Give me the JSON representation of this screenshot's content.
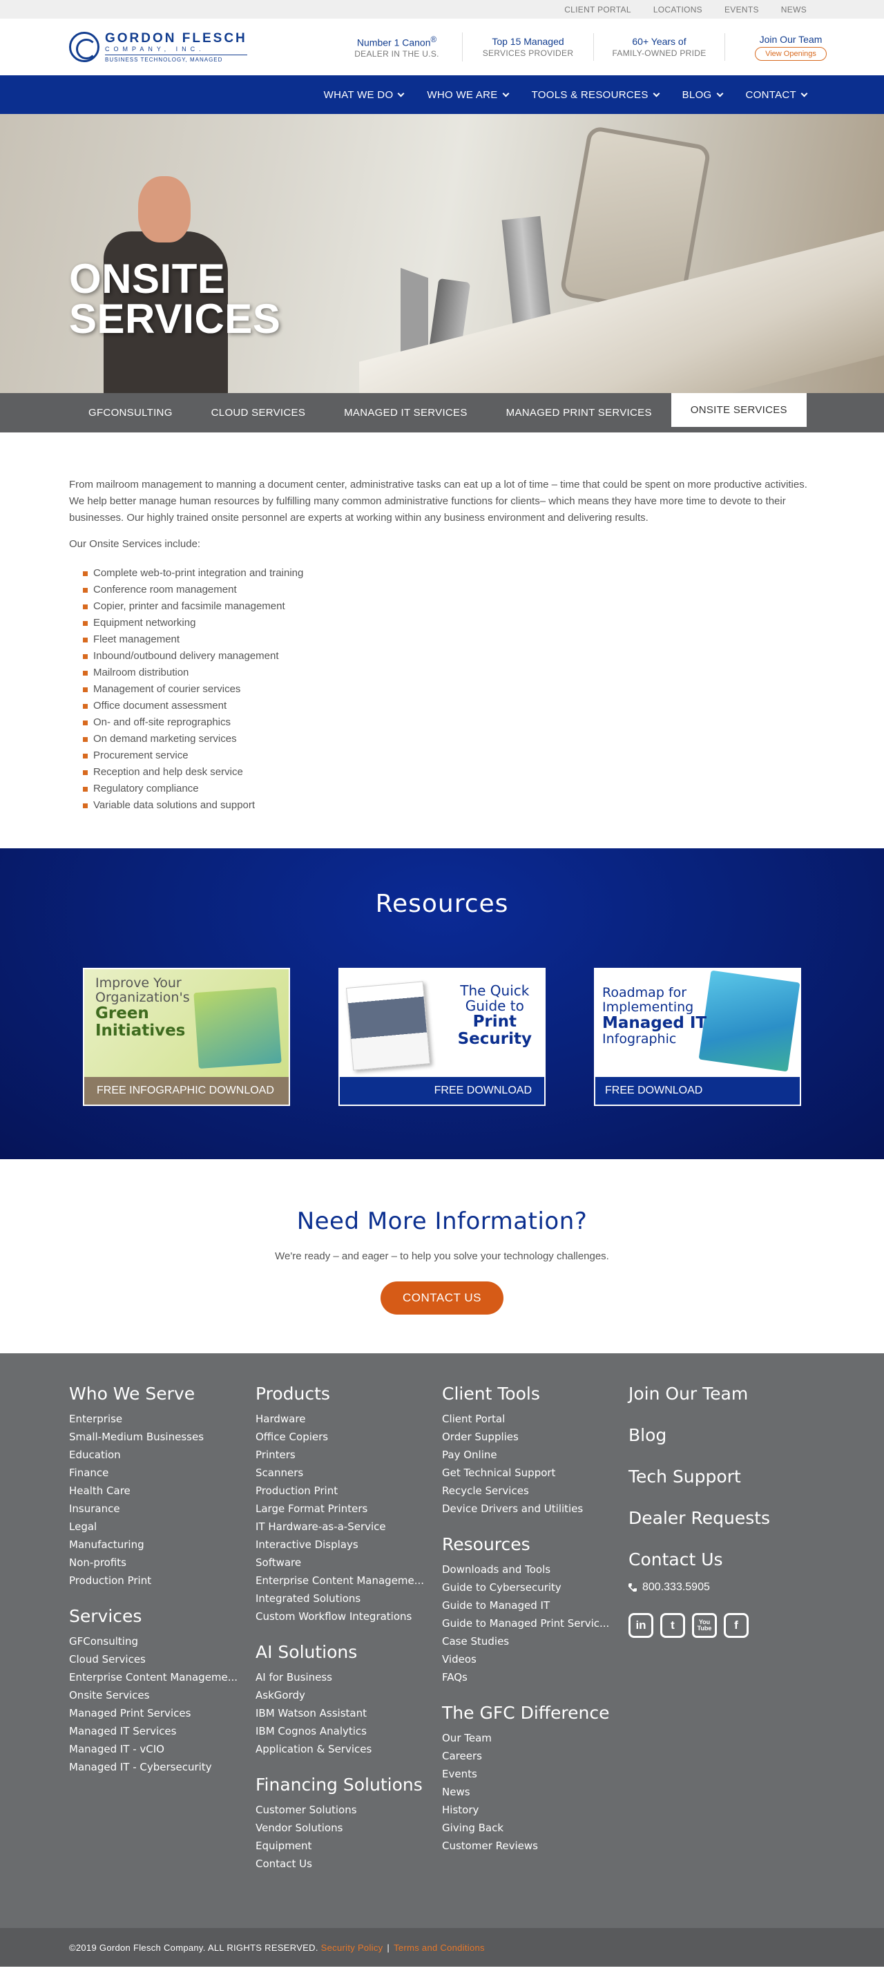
{
  "utility": [
    "CLIENT PORTAL",
    "LOCATIONS",
    "EVENTS",
    "NEWS"
  ],
  "logo": {
    "name": "GORDON FLESCH",
    "company": "COMPANY, INC.",
    "tagline": "BUSINESS TECHNOLOGY, MANAGED"
  },
  "badges": [
    {
      "top": "Number 1 Canon",
      "top_sup": "®",
      "bottom": "DEALER IN THE U.S."
    },
    {
      "top": "Top 15 Managed",
      "bottom": "SERVICES PROVIDER"
    },
    {
      "top": "60+ Years of",
      "bottom": "FAMILY-OWNED PRIDE"
    },
    {
      "top": "Join Our Team",
      "button": "View Openings"
    }
  ],
  "nav": [
    "WHAT WE DO",
    "WHO WE ARE",
    "TOOLS & RESOURCES",
    "BLOG",
    "CONTACT"
  ],
  "hero": {
    "title_line1": "ONSITE",
    "title_line2": "SERVICES"
  },
  "subtabs": [
    "GFCONSULTING",
    "CLOUD SERVICES",
    "MANAGED IT SERVICES",
    "MANAGED PRINT SERVICES",
    "ONSITE SERVICES"
  ],
  "content": {
    "intro": "From mailroom management to manning a document center, administrative tasks can eat up a lot of time – time that could be spent on more productive activities. We help better manage human resources by fulfilling many common administrative functions for clients– which means they have more time to devote to their businesses. Our highly trained onsite personnel are experts at working within any business environment and delivering results.",
    "list_heading": "Our Onsite Services include:",
    "services": [
      "Complete web-to-print integration and training",
      "Conference room management",
      "Copier, printer and facsimile management",
      "Equipment networking",
      "Fleet management",
      "Inbound/outbound delivery management",
      "Mailroom distribution",
      "Management of courier services",
      "Office document assessment",
      "On- and off-site reprographics",
      "On demand marketing services",
      "Procurement service",
      "Reception and help desk service",
      "Regulatory compliance",
      "Variable data solutions and support"
    ]
  },
  "resources": {
    "heading": "Resources",
    "cards": [
      {
        "l1": "Improve Your",
        "l2": "Organization's",
        "l3": "Green",
        "l4": "Initiatives",
        "footer": "FREE INFOGRAPHIC DOWNLOAD"
      },
      {
        "l1": "The Quick",
        "l2": "Guide to",
        "l3": "Print",
        "l4": "Security",
        "footer": "FREE DOWNLOAD"
      },
      {
        "l1": "Roadmap for",
        "l2": "Implementing",
        "l3": "Managed IT",
        "l4": "Infographic",
        "footer": "FREE DOWNLOAD"
      }
    ]
  },
  "cta": {
    "heading": "Need More Information?",
    "text": "We're ready – and eager – to help you solve your technology challenges.",
    "button": "CONTACT US"
  },
  "footer": {
    "who_we_serve": {
      "title": "Who We Serve",
      "items": [
        "Enterprise",
        "Small-Medium Businesses",
        "Education",
        "Finance",
        "Health Care",
        "Insurance",
        "Legal",
        "Manufacturing",
        "Non-profits",
        "Production Print"
      ]
    },
    "services": {
      "title": "Services",
      "items": [
        "GFConsulting",
        "Cloud Services",
        "Enterprise Content Manageme...",
        "Onsite Services",
        "Managed Print Services",
        "Managed IT Services",
        "Managed IT - vCIO",
        "Managed IT - Cybersecurity"
      ]
    },
    "products": {
      "title": "Products",
      "items": [
        "Hardware",
        "Office Copiers",
        "Printers",
        "Scanners",
        "Production Print",
        "Large Format Printers",
        "IT Hardware-as-a-Service",
        "Interactive Displays",
        "Software",
        "Enterprise Content Manageme...",
        "Integrated Solutions",
        "Custom Workflow Integrations"
      ]
    },
    "ai": {
      "title": "AI Solutions",
      "items": [
        "AI for Business",
        "AskGordy",
        "IBM Watson Assistant",
        "IBM Cognos Analytics",
        "Application & Services"
      ]
    },
    "financing": {
      "title": "Financing Solutions",
      "items": [
        "Customer Solutions",
        "Vendor Solutions",
        "Equipment",
        "Contact Us"
      ]
    },
    "client_tools": {
      "title": "Client Tools",
      "items": [
        "Client Portal",
        "Order Supplies",
        "Pay Online",
        "Get Technical Support",
        "Recycle Services",
        "Device Drivers and Utilities"
      ]
    },
    "resources": {
      "title": "Resources",
      "items": [
        "Downloads and Tools",
        "Guide to Cybersecurity",
        "Guide to Managed IT",
        "Guide to Managed Print Servic...",
        "Case Studies",
        "Videos",
        "FAQs"
      ]
    },
    "difference": {
      "title": "The GFC Difference",
      "items": [
        "Our Team",
        "Careers",
        "Events",
        "News",
        "History",
        "Giving Back",
        "Customer Reviews"
      ]
    },
    "right": [
      "Join Our Team",
      "Blog",
      "Tech Support",
      "Dealer Requests"
    ],
    "contact_title": "Contact Us",
    "phone": "800.333.5905",
    "social": [
      "in",
      "t",
      "You Tube",
      "f"
    ]
  },
  "bottom": {
    "copyright": "©2019 Gordon Flesch Company. ALL RIGHTS RESERVED.",
    "security": "Security Policy",
    "sep": "|",
    "terms": "Terms and Conditions"
  }
}
